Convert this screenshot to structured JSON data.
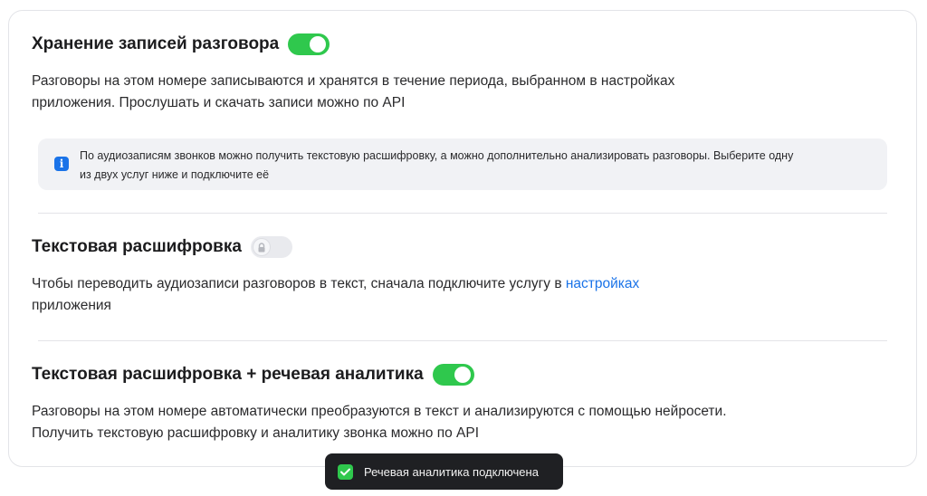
{
  "recording": {
    "title": "Хранение записей разговора",
    "toggle_on": true,
    "desc_line1": "Разговоры на этом номере записываются и хранятся в течение периода, выбранном в настройках",
    "desc_line2": "приложения. Прослушать и скачать записи можно по API"
  },
  "info_box": {
    "line1": "По аудиозаписям звонков можно получить текстовую расшифровку, а можно дополнительно анализировать разговоры. Выберите одну",
    "line2": "из двух услуг ниже и подключите её",
    "icon": "info-icon"
  },
  "transcription": {
    "title": "Текстовая расшифровка",
    "toggle_on": false,
    "locked": true,
    "desc_prefix": "Чтобы переводить аудиозаписи разговоров в текст, сначала подключите услугу в ",
    "desc_link": "настройках",
    "desc_line2": "приложения"
  },
  "analytics": {
    "title": "Текстовая расшифровка + речевая аналитика",
    "toggle_on": true,
    "desc_line1": "Разговоры на этом номере автоматически преобразуются в текст и анализируются с помощью нейросети.",
    "desc_line2": "Получить текстовую расшифровку и аналитику звонка можно по API"
  },
  "toast": {
    "message": "Речевая аналитика подключена",
    "icon": "check-icon"
  },
  "colors": {
    "toggle_on": "#2fc84d",
    "link": "#1a73e8",
    "toast_bg": "#1f2023"
  }
}
